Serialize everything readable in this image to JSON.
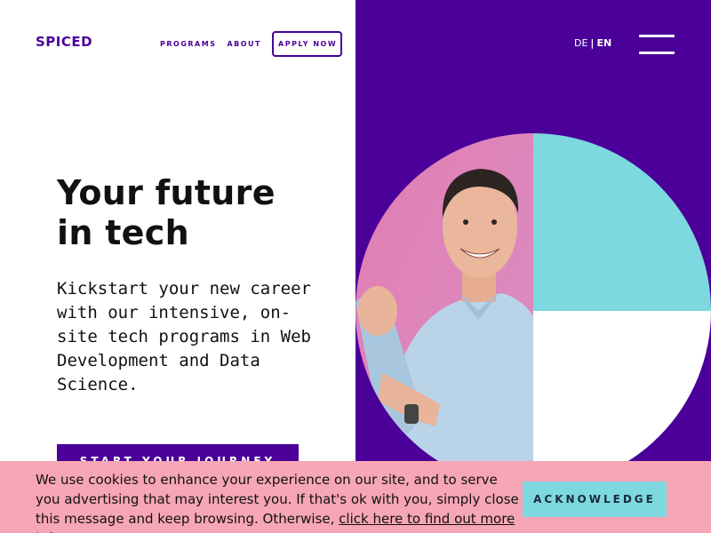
{
  "brand": {
    "logo_text": "SPICED"
  },
  "nav": {
    "programs": "PROGRAMS",
    "about": "ABOUT",
    "apply": "APPLY NOW"
  },
  "lang": {
    "de": "DE",
    "separator": "|",
    "en": "EN",
    "active": "EN"
  },
  "hero": {
    "title_line1": "Your future",
    "title_line2": "in tech",
    "text": "Kickstart your new career with our intensive, on-site tech programs in Web Development and Data Science.",
    "cta": "START YOUR JOURNEY"
  },
  "cookie": {
    "text": "We use cookies to enhance your experience on our site, and to serve you advertising that may interest you. If that's ok with you, simply close this message and keep browsing. Otherwise, ",
    "link": "click here to find out more info.",
    "button": "ACKNOWLEDGE"
  },
  "colors": {
    "brand_purple": "#4a0099",
    "accent_cyan": "#7dd8e0",
    "photo_pink": "#e58fbf",
    "cookie_pink": "#f7a6b5"
  },
  "icons": {
    "menu": "hamburger-menu-icon"
  }
}
